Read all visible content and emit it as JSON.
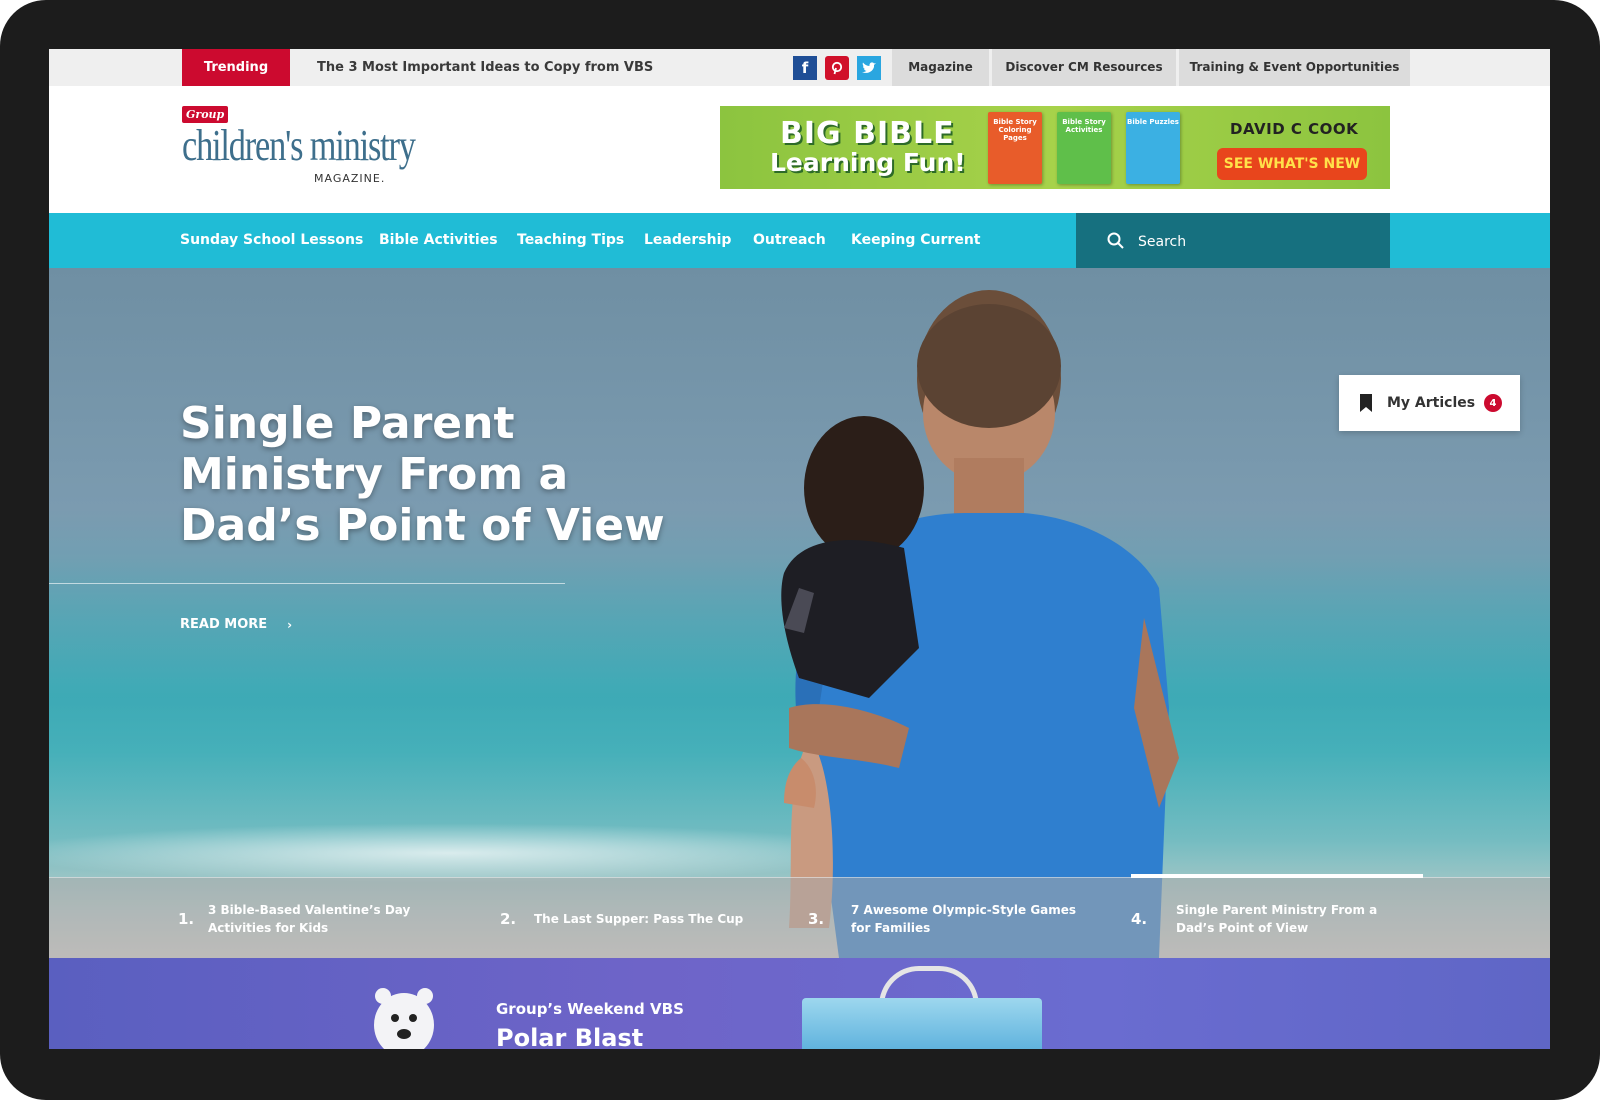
{
  "topbar": {
    "trending_label": "Trending",
    "trending_headline": "The 3 Most Important Ideas to Copy from VBS",
    "social": [
      "facebook-icon",
      "pinterest-icon",
      "twitter-icon"
    ],
    "links": [
      "Magazine",
      "Discover CM Resources",
      "Training & Event Opportunities"
    ]
  },
  "header": {
    "logo": {
      "badge": "Group",
      "main": "children's ministry",
      "sub": "MAGAZINE."
    },
    "ad": {
      "headline_line1": "BIG BIBLE",
      "headline_line2": "Learning Fun!",
      "books": [
        "Bible Story Coloring Pages",
        "Bible Story Activities",
        "Bible Puzzles"
      ],
      "brand": "DAVID C COOK",
      "cta": "SEE WHAT'S NEW"
    }
  },
  "nav": {
    "items": [
      "Sunday School Lessons",
      "Bible Activities",
      "Teaching Tips",
      "Leadership",
      "Outreach",
      "Keeping Current"
    ],
    "search_placeholder": "Search"
  },
  "hero": {
    "title": "Single Parent Ministry From a Dad’s Point of View",
    "read_more": "READ MORE",
    "my_articles": {
      "label": "My Articles",
      "count": "4"
    }
  },
  "slides": [
    {
      "num": "1.",
      "title": "3 Bible-Based Valentine’s Day Activities for Kids"
    },
    {
      "num": "2.",
      "title": "The Last Supper: Pass The Cup"
    },
    {
      "num": "3.",
      "title": "7 Awesome Olympic-Style Games for Families"
    },
    {
      "num": "4.",
      "title": "Single Parent Ministry From a Dad’s Point of View"
    }
  ],
  "promo": {
    "eyebrow": "Group’s Weekend VBS",
    "title": "Polar Blast"
  },
  "colors": {
    "brand_red": "#cc0a2f",
    "nav_teal": "#20bcd6",
    "search_dark_teal": "#16707f",
    "logo_blue": "#3e6f8c"
  }
}
